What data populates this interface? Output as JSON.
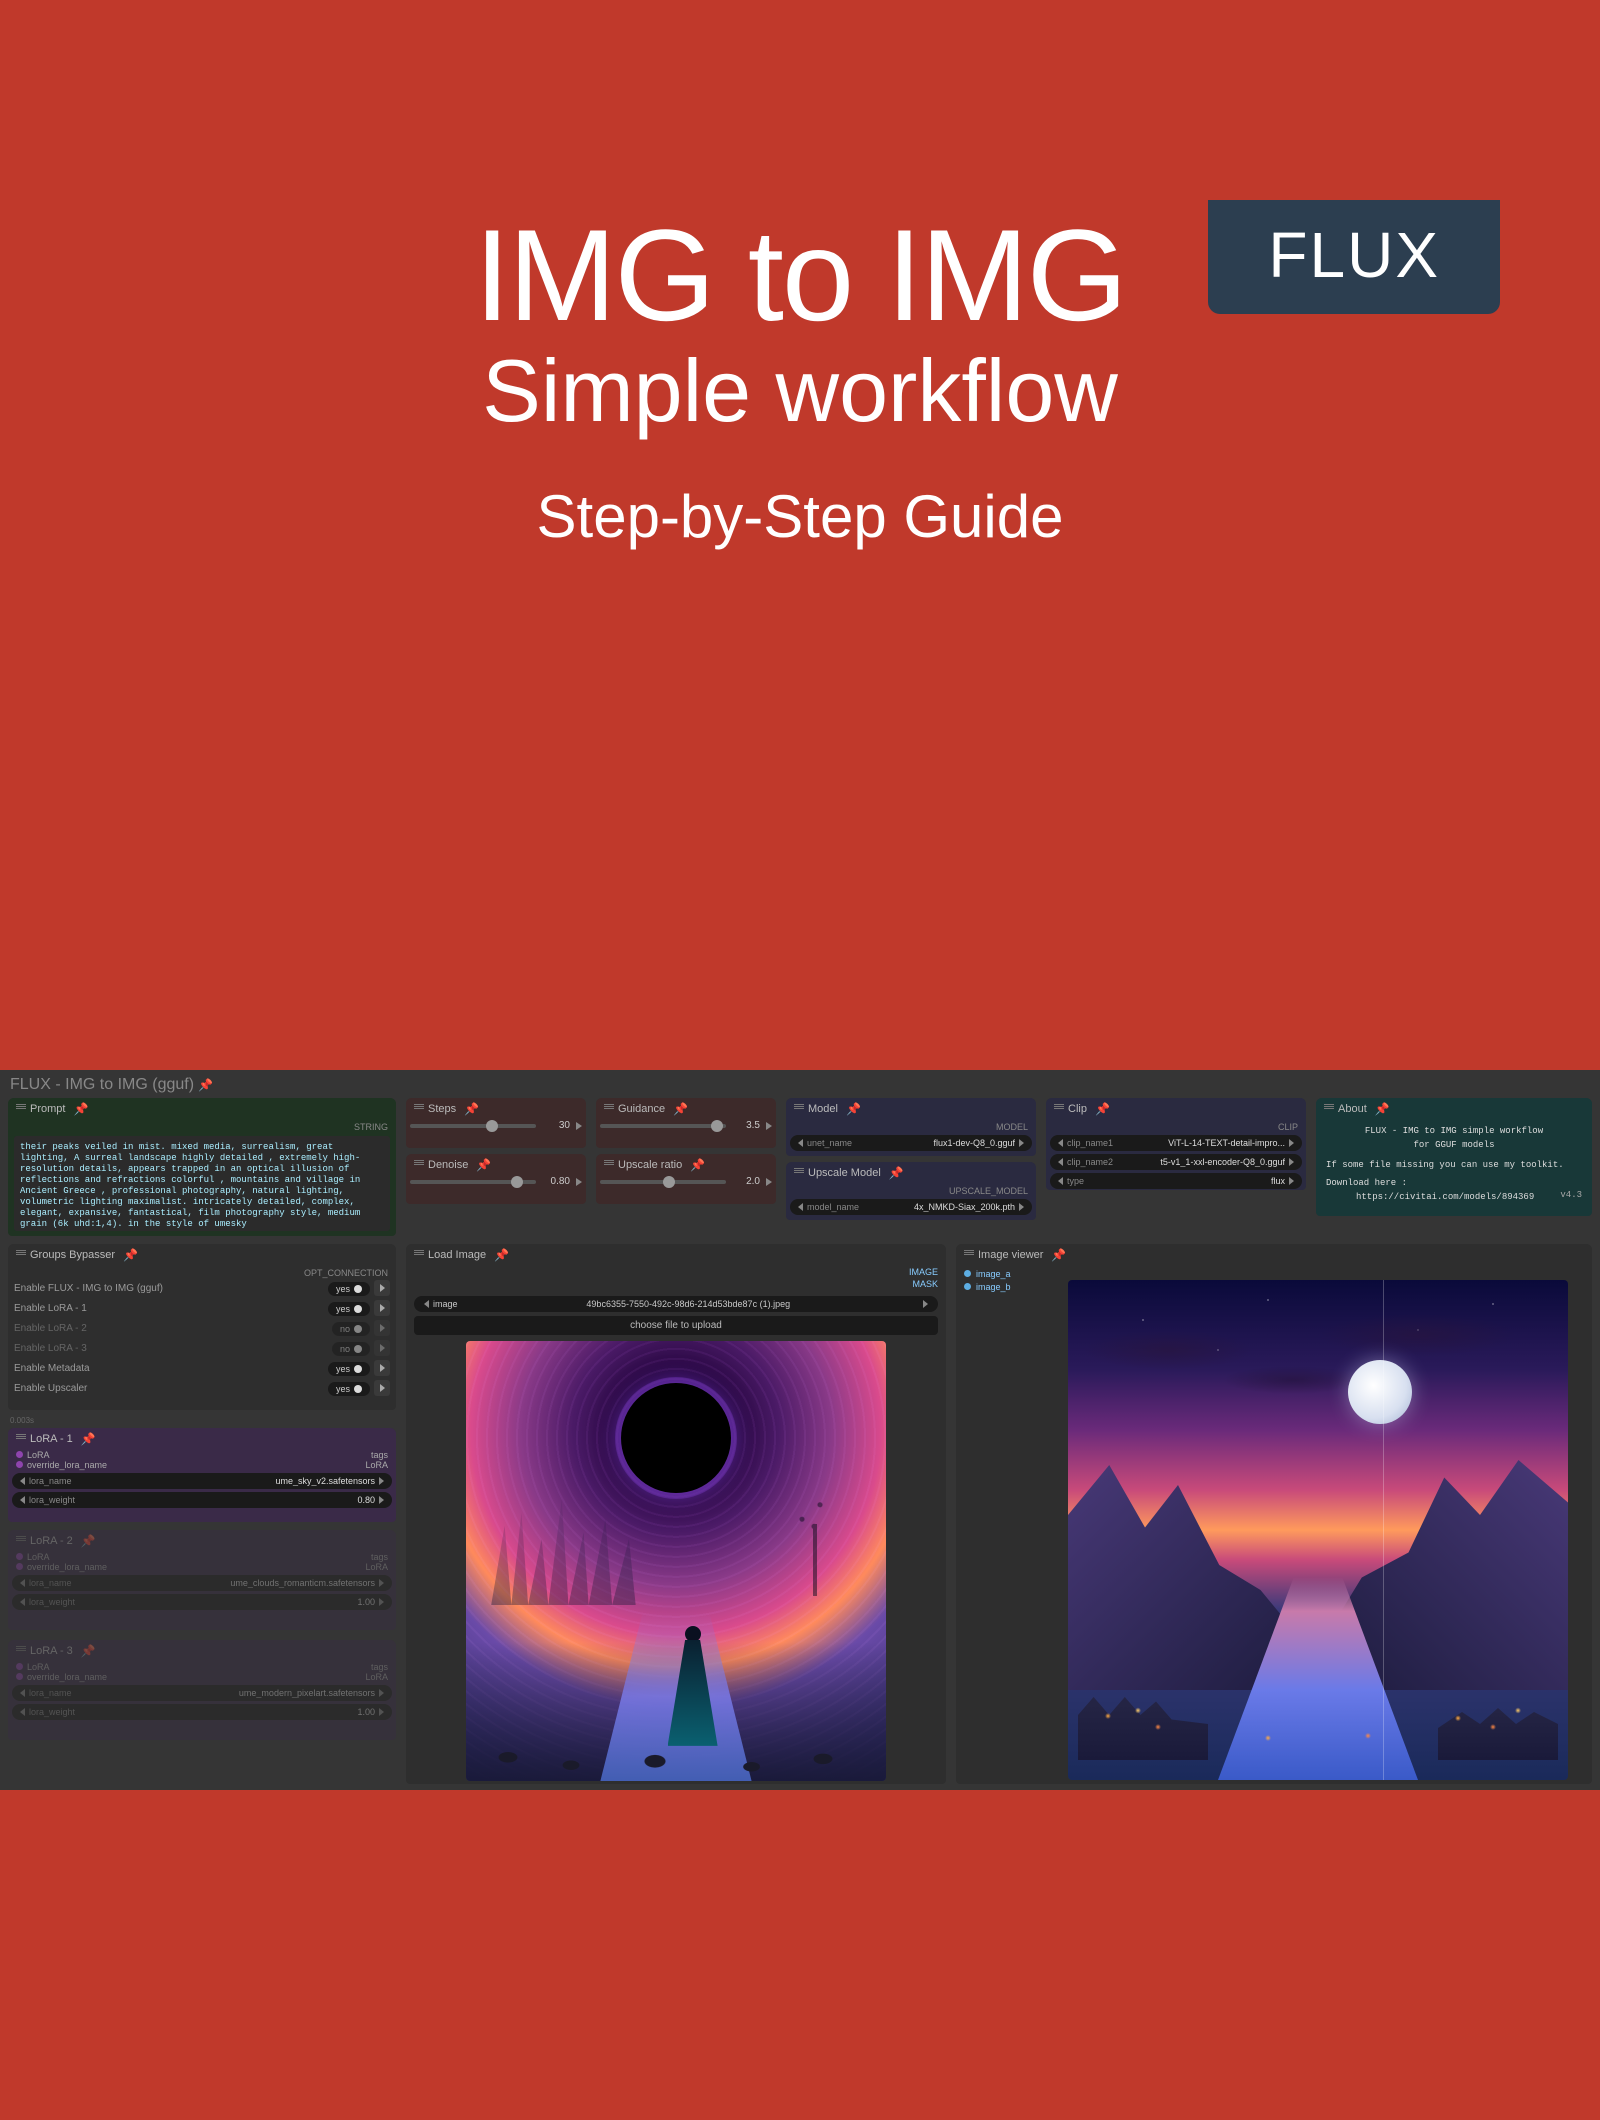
{
  "badge": "FLUX",
  "headline": {
    "t1": "IMG to IMG",
    "t2": "Simple workflow",
    "t3": "Step-by-Step Guide"
  },
  "workflow_title": "FLUX - IMG to IMG (gguf)",
  "prompt": {
    "title": "Prompt",
    "type": "STRING",
    "text": "their peaks veiled in mist. mixed media, surrealism, great lighting, A surreal landscape highly detailed , extremely high-resolution details, appears trapped in an optical illusion of reflections and refractions colorful , mountains and village in Ancient Greece , professional photography, natural lighting, volumetric lighting maximalist. intricately detailed, complex, elegant, expansive, fantastical, film photography style, medium grain  (6k uhd:1,4). in the style of umesky"
  },
  "sliders": {
    "steps": {
      "title": "Steps",
      "value": "30",
      "pos": 60
    },
    "guidance": {
      "title": "Guidance",
      "value": "3.5",
      "pos": 88
    },
    "denoise": {
      "title": "Denoise",
      "value": "0.80",
      "pos": 80
    },
    "upratio": {
      "title": "Upscale ratio",
      "value": "2.0",
      "pos": 50
    }
  },
  "model": {
    "title": "Model",
    "type": "MODEL",
    "field": {
      "label": "unet_name",
      "value": "flux1-dev-Q8_0.gguf"
    }
  },
  "upscale_model": {
    "title": "Upscale Model",
    "type": "UPSCALE_MODEL",
    "field": {
      "label": "model_name",
      "value": "4x_NMKD-Siax_200k.pth"
    }
  },
  "clip": {
    "title": "Clip",
    "type": "CLIP",
    "fields": [
      {
        "label": "clip_name1",
        "value": "ViT-L-14-TEXT-detail-impro..."
      },
      {
        "label": "clip_name2",
        "value": "t5-v1_1-xxl-encoder-Q8_0.gguf"
      },
      {
        "label": "type",
        "value": "flux"
      }
    ]
  },
  "about": {
    "title": "About",
    "line1": "FLUX - IMG to IMG simple workflow",
    "line2": "for GGUF models",
    "line3": "If some file missing you can use my toolkit.",
    "line4": "Download here :",
    "line5": "https://civitai.com/models/894369",
    "version": "v4.3"
  },
  "groups": {
    "title": "Groups Bypasser",
    "type": "OPT_CONNECTION",
    "rows": [
      {
        "label": "Enable FLUX - IMG to IMG (gguf)",
        "value": "yes",
        "on": true
      },
      {
        "label": "Enable LoRA - 1",
        "value": "yes",
        "on": true
      },
      {
        "label": "Enable LoRA - 2",
        "value": "no",
        "on": false
      },
      {
        "label": "Enable LoRA - 3",
        "value": "no",
        "on": false
      },
      {
        "label": "Enable Metadata",
        "value": "yes",
        "on": true
      },
      {
        "label": "Enable Upscaler",
        "value": "yes",
        "on": true
      }
    ]
  },
  "timer": "0.003s",
  "lora1": {
    "title": "LoRA - 1",
    "tags": "tags",
    "sock_in": "LoRA",
    "sock_out": "LoRA",
    "override": "override_lora_name",
    "fields": [
      {
        "label": "lora_name",
        "value": "ume_sky_v2.safetensors"
      },
      {
        "label": "lora_weight",
        "value": "0.80"
      }
    ]
  },
  "lora2": {
    "title": "LoRA - 2",
    "tags": "tags",
    "sock_in": "LoRA",
    "sock_out": "LoRA",
    "override": "override_lora_name",
    "fields": [
      {
        "label": "lora_name",
        "value": "ume_clouds_romanticm.safetensors"
      },
      {
        "label": "lora_weight",
        "value": "1.00"
      }
    ]
  },
  "lora3": {
    "title": "LoRA - 3",
    "tags": "tags",
    "sock_in": "LoRA",
    "sock_out": "LoRA",
    "override": "override_lora_name",
    "fields": [
      {
        "label": "lora_name",
        "value": "ume_modern_pixelart.safetensors"
      },
      {
        "label": "lora_weight",
        "value": "1.00"
      }
    ]
  },
  "load_image": {
    "title": "Load Image",
    "out1": "IMAGE",
    "out2": "MASK",
    "field_label": "image",
    "filename": "49bc6355-7550-492c-98d6-214d53bde87c (1).jpeg",
    "choose": "choose file to upload"
  },
  "viewer": {
    "title": "Image viewer",
    "in1": "image_a",
    "in2": "image_b"
  }
}
